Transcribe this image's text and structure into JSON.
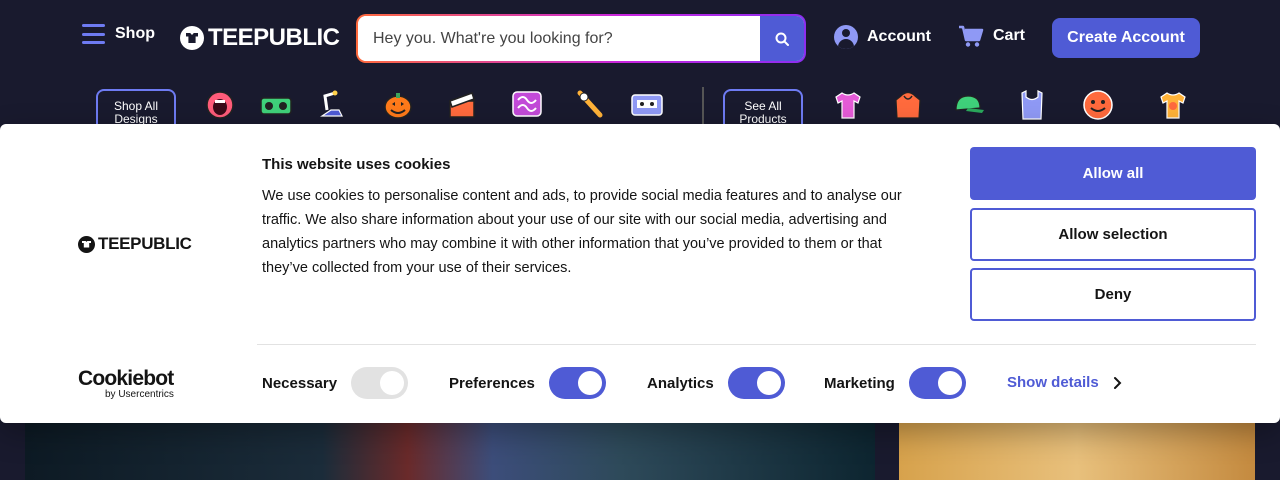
{
  "header": {
    "shop_label": "Shop",
    "logo_text": "TEEPUBLIC",
    "search_placeholder": "Hey you. What're you looking for?",
    "account_label": "Account",
    "cart_label": "Cart",
    "create_account_label": "Create Account"
  },
  "categories": {
    "shop_all_designs": "Shop All Designs",
    "see_all_products": "See All Products",
    "design_icons": [
      "screaming-mouth-icon",
      "boombox-icon",
      "robot-arm-icon",
      "jack-o-lantern-icon",
      "clapperboard-icon",
      "squiggle-monster-icon",
      "baseball-bat-icon",
      "cassette-tape-icon"
    ],
    "product_icons": [
      "tshirt-icon",
      "hoodie-icon",
      "cap-icon",
      "tank-top-icon",
      "sticker-icon",
      "kids-tshirt-icon"
    ]
  },
  "cookie": {
    "logo_text": "TEEPUBLIC",
    "title": "This website uses cookies",
    "body": "We use cookies to personalise content and ads, to provide social media features and to analyse our traffic. We also share information about your use of our site with our social media, advertising and analytics partners who may combine it with other information that you’ve provided to them or that they’ve collected from your use of their services.",
    "allow_all": "Allow all",
    "allow_selection": "Allow selection",
    "deny": "Deny",
    "cookiebot_name": "Cookiebot",
    "cookiebot_sub": "by Usercentrics",
    "necessary": "Necessary",
    "preferences": "Preferences",
    "analytics": "Analytics",
    "marketing": "Marketing",
    "show_details": "Show details"
  },
  "colors": {
    "header_bg": "#191a2e",
    "accent": "#4f5bd5",
    "accent_light": "#6e7bf2"
  }
}
